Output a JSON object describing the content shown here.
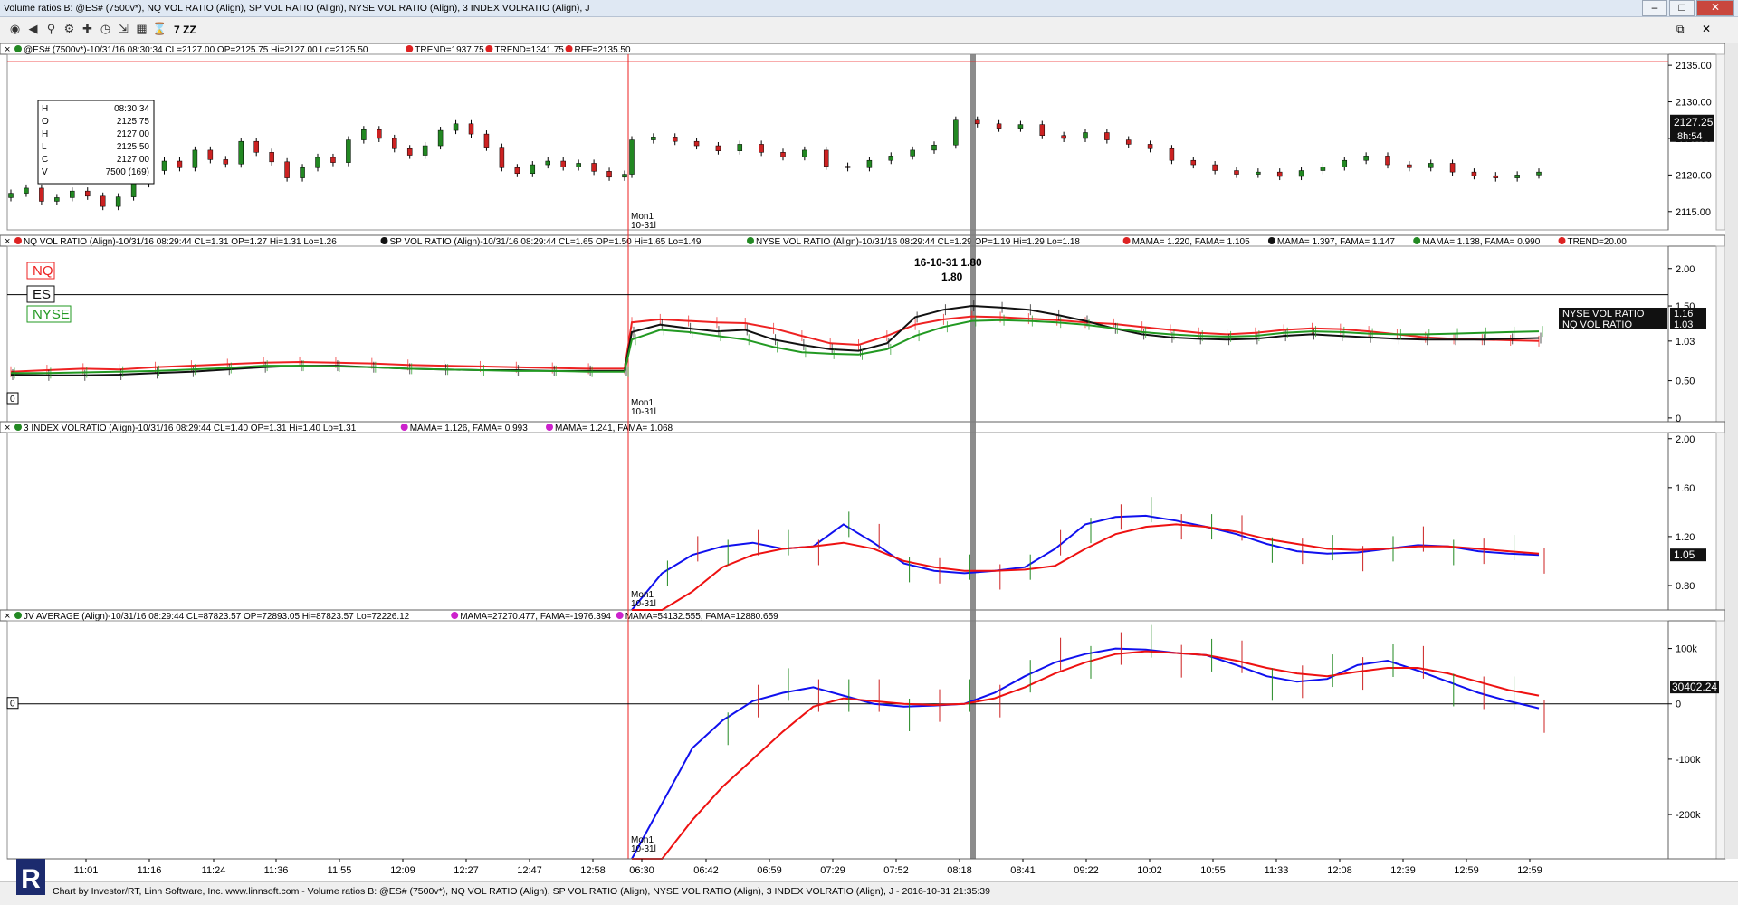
{
  "window": {
    "title": "Volume ratios B: @ES# (7500v*), NQ VOL RATIO (Align), SP VOL RATIO (Align), NYSE VOL RATIO (Align), 3 INDEX VOLRATIO (Align), J",
    "minimize_label": "–",
    "maximize_label": "□",
    "close_label": "✕"
  },
  "toolbar": {
    "icons": [
      "globe-icon",
      "back-icon",
      "zoom-icon",
      "settings-icon",
      "crosshair-icon",
      "clock-icon",
      "export-icon",
      "grid-icon",
      "hourglass-icon"
    ],
    "zz_label": "7 ZZ",
    "restore_label": "⧉"
  },
  "time_axis": {
    "labels": [
      "11:01",
      "11:16",
      "11:24",
      "11:36",
      "11:55",
      "12:09",
      "12:27",
      "12:47",
      "12:58",
      "06:30",
      "06:42",
      "06:59",
      "07:29",
      "07:52",
      "08:18",
      "08:41",
      "09:22",
      "10:02",
      "10:55",
      "11:33",
      "12:08",
      "12:39",
      "12:59",
      "12:59"
    ],
    "session_marker": [
      "Mon1",
      "10-31l"
    ]
  },
  "panes": [
    {
      "id": "es",
      "header": [
        {
          "text": "@ES# (7500v*)-10/31/16 08:30:34 CL=2127.00 OP=2125.75 Hi=2127.00 Lo=2125.50",
          "dot": "#228822"
        },
        {
          "text": "TREND=1937.75",
          "dot": "#dd2222"
        },
        {
          "text": "TREND=1341.75",
          "dot": "#dd2222"
        },
        {
          "text": "REF=2135.50",
          "dot": "#dd2222"
        }
      ],
      "y_ticks": [
        "2135.00",
        "2130.00",
        "2125.00",
        "2120.00",
        "2115.00"
      ],
      "price_tag": "2127.25",
      "timer_tag": "8h:54",
      "ohlc_box": [
        {
          "k": "H",
          "v": "08:30:34"
        },
        {
          "k": "O",
          "v": "2125.75"
        },
        {
          "k": "H",
          "v": "2127.00"
        },
        {
          "k": "L",
          "v": "2125.50"
        },
        {
          "k": "C",
          "v": "2127.00"
        },
        {
          "k": "V",
          "v": "7500 (169)"
        }
      ],
      "ref_line": 2135.5
    },
    {
      "id": "vol",
      "header": [
        {
          "text": "NQ VOL RATIO (Align)-10/31/16 08:29:44 CL=1.31 OP=1.27 Hi=1.31 Lo=1.26",
          "dot": "#dd2222"
        },
        {
          "text": "SP VOL RATIO (Align)-10/31/16 08:29:44 CL=1.65 OP=1.50 Hi=1.65 Lo=1.49",
          "dot": "#111111"
        },
        {
          "text": "NYSE VOL RATIO (Align)-10/31/16 08:29:44 CL=1.29 OP=1.19 Hi=1.29 Lo=1.18",
          "dot": "#228822"
        },
        {
          "text": "MAMA=  1.220, FAMA=  1.105",
          "dot": "#dd2222"
        },
        {
          "text": "MAMA=  1.397, FAMA=  1.147",
          "dot": "#111111"
        },
        {
          "text": "MAMA=  1.138, FAMA=  0.990",
          "dot": "#228822"
        },
        {
          "text": "TREND=20.00",
          "dot": "#dd2222"
        }
      ],
      "y_ticks": [
        "2.00",
        "1.50",
        "1.03",
        "0.50",
        "0"
      ],
      "legend": [
        {
          "label": "NQ",
          "color": "#ee2222"
        },
        {
          "label": "ES",
          "color": "#111111"
        },
        {
          "label": "NYSE",
          "color": "#229922"
        }
      ],
      "tags": [
        {
          "label": "NYSE VOL RATIO",
          "value": "1.16"
        },
        {
          "label": "NQ VOL RATIO",
          "value": "1.03"
        }
      ],
      "annotation": [
        "16-10-31  1.80",
        "1.80"
      ],
      "zero_label": "0"
    },
    {
      "id": "idx3",
      "header": [
        {
          "text": "3 INDEX VOLRATIO (Align)-10/31/16 08:29:44 CL=1.40 OP=1.31 Hi=1.40 Lo=1.31",
          "dot": "#228822"
        },
        {
          "text": "MAMA=  1.126, FAMA=  0.993",
          "dot": "#cc22cc"
        },
        {
          "text": "MAMA=  1.241, FAMA=  1.068",
          "dot": "#cc22cc"
        }
      ],
      "y_ticks": [
        "2.00",
        "1.60",
        "1.20",
        "0.80"
      ],
      "price_tag": "1.05"
    },
    {
      "id": "jv",
      "header": [
        {
          "text": "JV AVERAGE (Align)-10/31/16 08:29:44 CL=87823.57 OP=72893.05 Hi=87823.57 Lo=72226.12",
          "dot": "#228822"
        },
        {
          "text": "MAMA=27270.477, FAMA=-1976.394",
          "dot": "#cc22cc"
        },
        {
          "text": "MAMA=54132.555, FAMA=12880.659",
          "dot": "#cc22cc"
        }
      ],
      "y_ticks": [
        "100k",
        "0",
        "-100k",
        "-200k"
      ],
      "price_tag": "30402.24",
      "zero_label": "0"
    }
  ],
  "colors": {
    "up": "#228822",
    "down": "#cc2222",
    "mama_blue": "#1010ee",
    "fama_red": "#ee1111",
    "sp_black": "#111111",
    "nyse_green": "#22aa22",
    "divider": "#808080",
    "session": "#ee2222"
  },
  "statusbar": {
    "text": "Chart by Investor/RT, Linn Software, Inc. www.linnsoft.com - Volume ratios B: @ES# (7500v*), NQ VOL RATIO (Align), SP VOL RATIO (Align), NYSE VOL RATIO (Align), 3 INDEX VOLRATIO (Align), J - 2016-10-31 21:35:39"
  },
  "chart_data": [
    {
      "type": "candlestick",
      "title": "@ES# (7500v*)",
      "ylim": [
        2112.5,
        2136.5
      ],
      "x_sessions": [
        "prior-day",
        "2016-10-31"
      ],
      "closes": [
        2117.5,
        2118.2,
        2116.4,
        2116.9,
        2117.8,
        2117.1,
        2115.7,
        2117.0,
        2118.8,
        2120.6,
        2121.9,
        2121.0,
        2123.4,
        2122.1,
        2121.5,
        2124.6,
        2123.1,
        2121.8,
        2119.6,
        2121.0,
        2122.4,
        2121.7,
        2124.8,
        2126.2,
        2125.0,
        2123.6,
        2122.7,
        2124.0,
        2126.1,
        2127.0,
        2125.6,
        2123.8,
        2121.0,
        2120.2,
        2121.4,
        2121.9,
        2121.1,
        2121.6,
        2120.5,
        2119.7,
        2120.1,
        2124.8,
        2125.2,
        2124.6,
        2124.0,
        2123.3,
        2124.2,
        2123.1,
        2122.5,
        2123.4,
        2121.2,
        2121.0,
        2122.0,
        2122.6,
        2123.4,
        2124.1,
        2127.5,
        2127.0,
        2126.4,
        2126.9,
        2125.4,
        2125.0,
        2125.8,
        2124.8,
        2124.2,
        2123.6,
        2122.0,
        2121.4,
        2120.6,
        2120.1,
        2120.4,
        2119.8,
        2120.6,
        2121.1,
        2122.0,
        2122.6,
        2121.4,
        2121.0,
        2121.6,
        2120.4,
        2119.9,
        2119.6,
        2120.0,
        2120.4
      ],
      "last": 2127.25,
      "ref": 2135.5
    },
    {
      "type": "line",
      "title": "NQ / SP / NYSE VOL RATIO (Align)",
      "ylim": [
        -0.05,
        2.3
      ],
      "series": [
        {
          "name": "NQ",
          "values": [
            0.62,
            0.64,
            0.66,
            0.65,
            0.68,
            0.7,
            0.72,
            0.74,
            0.75,
            0.74,
            0.73,
            0.71,
            0.7,
            0.69,
            0.68,
            0.67,
            0.66,
            0.66,
            1.28,
            1.32,
            1.3,
            1.28,
            1.27,
            1.2,
            1.1,
            1.0,
            0.98,
            1.1,
            1.25,
            1.32,
            1.36,
            1.35,
            1.33,
            1.31,
            1.28,
            1.26,
            1.22,
            1.18,
            1.14,
            1.12,
            1.14,
            1.18,
            1.2,
            1.19,
            1.16,
            1.12,
            1.08,
            1.06,
            1.05,
            1.04,
            1.03
          ]
        },
        {
          "name": "ES",
          "values": [
            0.58,
            0.57,
            0.57,
            0.58,
            0.6,
            0.62,
            0.65,
            0.68,
            0.7,
            0.7,
            0.68,
            0.66,
            0.65,
            0.64,
            0.64,
            0.63,
            0.63,
            0.63,
            1.15,
            1.25,
            1.2,
            1.16,
            1.18,
            1.05,
            0.98,
            0.92,
            0.9,
            1.0,
            1.35,
            1.45,
            1.5,
            1.48,
            1.45,
            1.38,
            1.3,
            1.2,
            1.12,
            1.08,
            1.06,
            1.05,
            1.06,
            1.1,
            1.12,
            1.1,
            1.08,
            1.06,
            1.05,
            1.05,
            1.05,
            1.06,
            1.07
          ]
        },
        {
          "name": "NYSE",
          "values": [
            0.6,
            0.6,
            0.61,
            0.62,
            0.63,
            0.65,
            0.67,
            0.7,
            0.7,
            0.69,
            0.68,
            0.66,
            0.65,
            0.64,
            0.63,
            0.63,
            0.62,
            0.62,
            1.05,
            1.18,
            1.15,
            1.1,
            1.05,
            0.95,
            0.88,
            0.86,
            0.85,
            0.92,
            1.1,
            1.22,
            1.3,
            1.31,
            1.3,
            1.28,
            1.25,
            1.2,
            1.15,
            1.12,
            1.1,
            1.09,
            1.1,
            1.14,
            1.16,
            1.15,
            1.13,
            1.12,
            1.12,
            1.13,
            1.14,
            1.15,
            1.16
          ]
        }
      ]
    },
    {
      "type": "line",
      "title": "3 INDEX VOLRATIO (Align)",
      "ylim": [
        0.6,
        2.05
      ],
      "series": [
        {
          "name": "MAMA",
          "values": [
            0.55,
            0.9,
            1.05,
            1.12,
            1.15,
            1.1,
            1.12,
            1.3,
            1.15,
            0.98,
            0.92,
            0.9,
            0.92,
            0.95,
            1.1,
            1.3,
            1.36,
            1.37,
            1.33,
            1.28,
            1.22,
            1.14,
            1.08,
            1.06,
            1.07,
            1.1,
            1.13,
            1.12,
            1.08,
            1.06,
            1.05
          ]
        },
        {
          "name": "FAMA",
          "values": [
            0.4,
            0.55,
            0.75,
            0.95,
            1.05,
            1.1,
            1.12,
            1.15,
            1.1,
            1.0,
            0.95,
            0.92,
            0.92,
            0.93,
            0.96,
            1.1,
            1.22,
            1.28,
            1.3,
            1.28,
            1.24,
            1.18,
            1.14,
            1.1,
            1.09,
            1.1,
            1.12,
            1.12,
            1.1,
            1.08,
            1.06
          ]
        }
      ],
      "last": 1.05
    },
    {
      "type": "line",
      "title": "JV AVERAGE (Align)",
      "ylim": [
        -280000,
        150000
      ],
      "series": [
        {
          "name": "MAMA",
          "values": [
            -300000,
            -180000,
            -80000,
            -30000,
            5000,
            20000,
            30000,
            15000,
            0,
            -5000,
            -3000,
            0,
            20000,
            50000,
            75000,
            90000,
            100000,
            98000,
            92000,
            88000,
            70000,
            50000,
            40000,
            45000,
            70000,
            78000,
            60000,
            40000,
            20000,
            5000,
            -8000
          ]
        },
        {
          "name": "FAMA",
          "values": [
            -300000,
            -280000,
            -210000,
            -150000,
            -100000,
            -50000,
            -5000,
            10000,
            5000,
            0,
            -2000,
            0,
            10000,
            30000,
            55000,
            75000,
            90000,
            95000,
            92000,
            88000,
            78000,
            65000,
            55000,
            50000,
            58000,
            65000,
            65000,
            55000,
            40000,
            25000,
            15000
          ]
        }
      ],
      "last": 30402.24
    }
  ]
}
